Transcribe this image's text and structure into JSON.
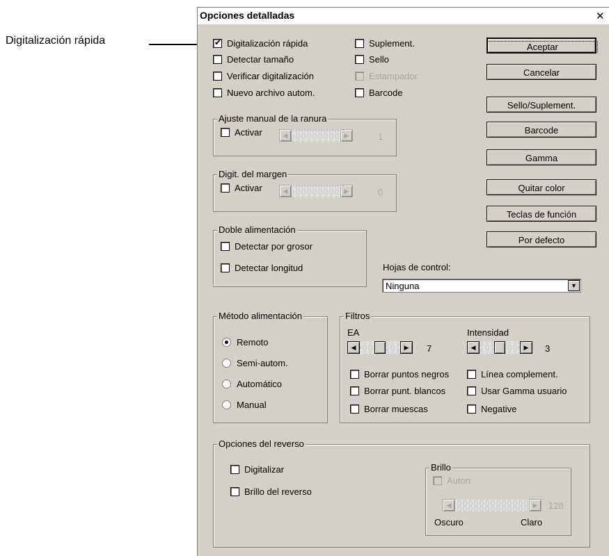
{
  "callout": {
    "label": "Digitalización rápida"
  },
  "window": {
    "title": "Opciones detalladas",
    "close_glyph": "✕"
  },
  "options": [
    {
      "label": "Digitalización rápida",
      "checked": true,
      "disabled": false
    },
    {
      "label": "Detectar tamaño",
      "checked": false,
      "disabled": false
    },
    {
      "label": "Verificar digitalización",
      "checked": false,
      "disabled": false
    },
    {
      "label": "Nuevo archivo autom.",
      "checked": false,
      "disabled": false
    },
    {
      "label": "Suplement.",
      "checked": false,
      "disabled": false
    },
    {
      "label": "Sello",
      "checked": false,
      "disabled": false
    },
    {
      "label": "Estampador",
      "checked": false,
      "disabled": true
    },
    {
      "label": "Barcode",
      "checked": false,
      "disabled": false
    }
  ],
  "buttons": {
    "ok": "Aceptar",
    "cancel": "Cancelar",
    "sello": "Sello/Suplement.",
    "barcode": "Barcode",
    "gamma": "Gamma",
    "quitar_color": "Quitar color",
    "teclas": "Teclas de función",
    "defecto": "Por defecto"
  },
  "slot_adjust": {
    "title": "Ajuste manual de la ranura",
    "enable": "Activar",
    "value": "1"
  },
  "margin": {
    "title": "Digit. del margen",
    "enable": "Activar",
    "value": "0"
  },
  "double_feed": {
    "title": "Doble alimentación",
    "thickness": "Detectar por grosor",
    "length": "Detectar longitud"
  },
  "control_sheets": {
    "label": "Hojas de control:",
    "value": "Ninguna"
  },
  "feed_method": {
    "title": "Método alimentación",
    "options": [
      "Remoto",
      "Semi-autom.",
      "Automático",
      "Manual"
    ],
    "selected": 0
  },
  "filters": {
    "title": "Filtros",
    "ea_label": "EA",
    "ea_value": "7",
    "ea_level": 0.5,
    "intensity_label": "Intensidad",
    "intensity_value": "3",
    "intensity_level": 0.5,
    "checks": [
      "Borrar puntos negros",
      "Línea complement.",
      "Borrar punt. blancos",
      "Usar Gamma usuario",
      "Borrar muescas",
      "Negative"
    ]
  },
  "reverse": {
    "title": "Opciones del reverso",
    "scan": "Digitalizar",
    "brightness_check": "Brillo del reverso",
    "brightness_group": "Brillo",
    "auto": "Auton",
    "value": "128",
    "dark": "Oscuro",
    "light": "Claro"
  },
  "icons": {
    "check": "✔",
    "left": "◀",
    "right": "▶",
    "down": "▼"
  }
}
